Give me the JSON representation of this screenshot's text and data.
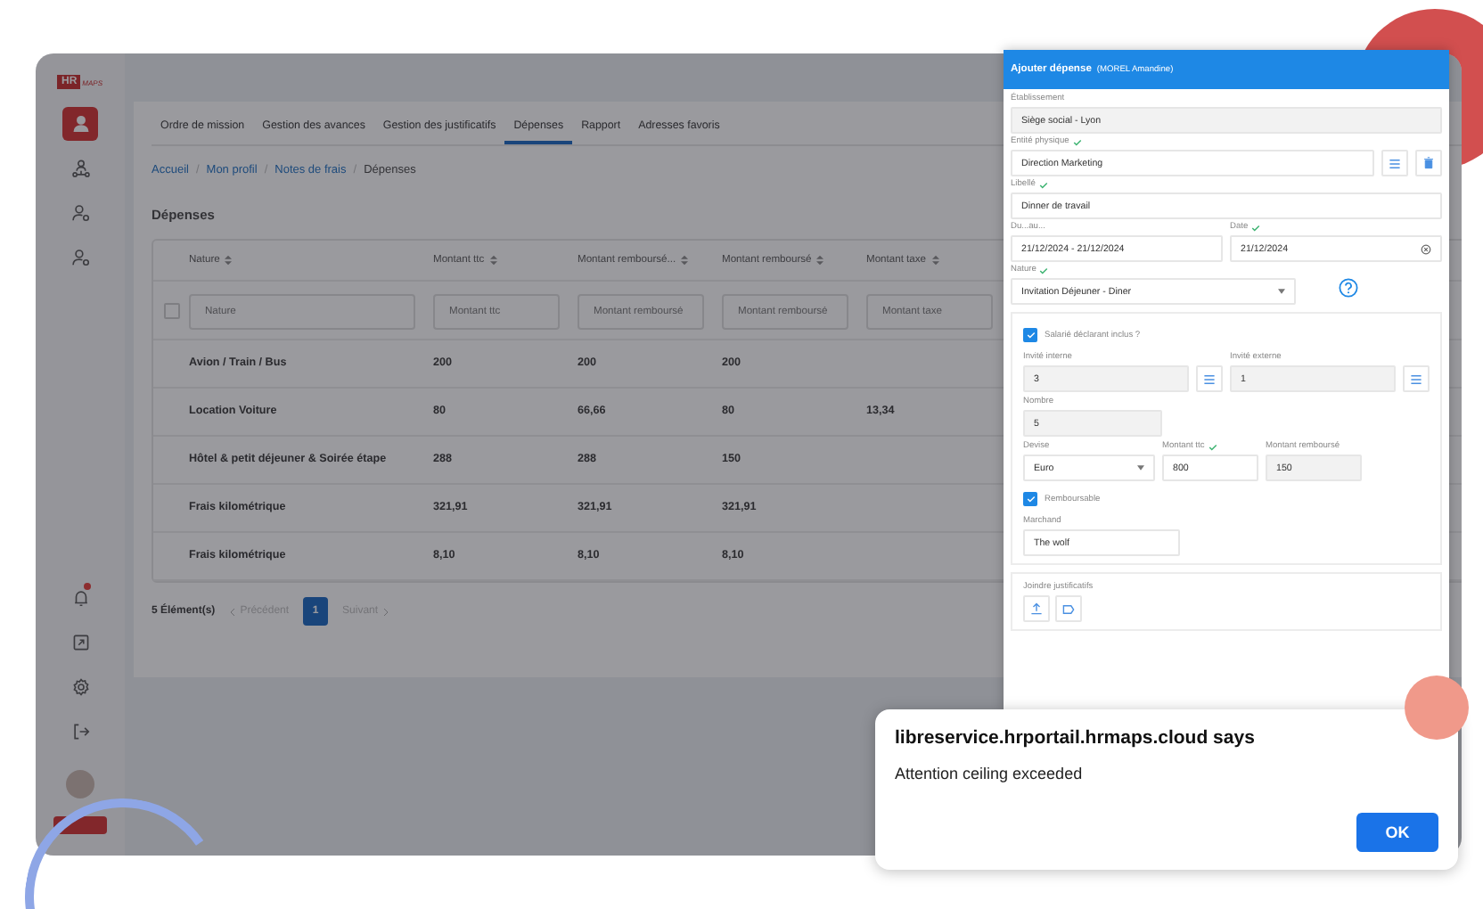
{
  "logo": {
    "mark": "HR",
    "name": "MAPS"
  },
  "sidebar": {
    "top_items": [
      {
        "kind": "person",
        "selected": true
      },
      {
        "kind": "network",
        "selected": false
      },
      {
        "kind": "person-gear",
        "selected": false
      },
      {
        "kind": "person-gear",
        "selected": false
      }
    ],
    "bottom_items": [
      {
        "kind": "bell",
        "badge": true
      },
      {
        "kind": "export",
        "badge": false
      },
      {
        "kind": "gear",
        "badge": false
      },
      {
        "kind": "logout",
        "badge": false
      }
    ]
  },
  "tabs": [
    {
      "label": "Ordre de mission",
      "selected": false
    },
    {
      "label": "Gestion des avances",
      "selected": false
    },
    {
      "label": "Gestion des justificatifs",
      "selected": false
    },
    {
      "label": "Dépenses",
      "selected": true
    },
    {
      "label": "Rapport",
      "selected": false
    },
    {
      "label": "Adresses favoris",
      "selected": false
    }
  ],
  "breadcrumb": {
    "separator": "/",
    "items": [
      {
        "label": "Accueil",
        "current": false
      },
      {
        "label": "Mon profil",
        "current": false
      },
      {
        "label": "Notes de frais",
        "current": false
      },
      {
        "label": "Dépenses",
        "current": true
      }
    ]
  },
  "page_title": "Dépenses",
  "table": {
    "columns": [
      "Nature",
      "Montant ttc",
      "Montant remboursé...",
      "Montant remboursé",
      "Montant taxe"
    ],
    "select_all": {
      "checked": false
    },
    "filters": [
      {
        "placeholder": "Nature"
      },
      {
        "placeholder": "Montant ttc"
      },
      {
        "placeholder": "Montant remboursé"
      },
      {
        "placeholder": "Montant remboursé"
      },
      {
        "placeholder": "Montant taxe"
      }
    ],
    "rows": [
      [
        "Avion / Train / Bus",
        "200",
        "200",
        "200",
        ""
      ],
      [
        "Location Voiture",
        "80",
        "66,66",
        "80",
        "13,34"
      ],
      [
        "Hôtel & petit déjeuner & Soirée étape",
        "288",
        "288",
        "150",
        ""
      ],
      [
        "Frais kilométrique",
        "321,91",
        "321,91",
        "321,91",
        ""
      ],
      [
        "Frais kilométrique",
        "8,10",
        "8,10",
        "8,10",
        ""
      ]
    ]
  },
  "pagination": {
    "count": "5 Élément(s)",
    "previous": "Précédent",
    "pages": [
      {
        "label": "1",
        "selected": true
      }
    ],
    "next": "Suivant"
  },
  "dialog": {
    "title": "Ajouter dépense",
    "subtitle": "(MOREL Amandine)",
    "rows": [
      [
        {
          "kind": "input",
          "label": "Établissement",
          "value": "Siège social - Lyon",
          "validated": false,
          "disabled": true
        }
      ],
      [
        {
          "kind": "input",
          "label": "Entité physique",
          "value": "Direction Marketing",
          "validated": true,
          "disabled": false
        },
        {
          "kind": "list-button"
        },
        {
          "kind": "trash-button"
        }
      ],
      [
        {
          "kind": "input",
          "label": "Libellé",
          "value": "Dinner de travail",
          "validated": true,
          "disabled": false
        }
      ],
      [
        {
          "kind": "input",
          "label": "Du...au...",
          "value": "21/12/2024 - 21/12/2024",
          "validated": false,
          "disabled": false
        },
        {
          "kind": "date",
          "label": "Date",
          "value": "21/12/2024",
          "validated": true,
          "disabled": false
        }
      ],
      [
        {
          "kind": "select",
          "label": "Nature",
          "value": "Invitation Déjeuner - Diner",
          "validated": true,
          "disabled": false
        },
        {
          "kind": "help"
        }
      ]
    ],
    "section_rows": [
      [
        {
          "kind": "checkbox",
          "label": "Salarié déclarant inclus ?",
          "checked": true
        }
      ],
      [
        {
          "kind": "input",
          "label": "Invité interne",
          "value": "3",
          "validated": false,
          "disabled": true
        },
        {
          "kind": "list-button"
        },
        {
          "kind": "input",
          "label": "Invité externe",
          "value": "1",
          "validated": false,
          "disabled": true
        },
        {
          "kind": "list-button"
        }
      ],
      [
        {
          "kind": "input",
          "label": "Nombre",
          "value": "5",
          "validated": false,
          "disabled": true
        }
      ],
      [
        {
          "kind": "select",
          "label": "Devise",
          "value": "Euro",
          "validated": false,
          "disabled": false
        },
        {
          "kind": "input",
          "label": "Montant ttc",
          "value": "800",
          "validated": true,
          "disabled": false
        },
        {
          "kind": "input",
          "label": "Montant remboursé",
          "value": "150",
          "validated": false,
          "disabled": true
        }
      ],
      [
        {
          "kind": "checkbox",
          "label": "Remboursable",
          "checked": true
        }
      ],
      [
        {
          "kind": "input",
          "label": "Marchand",
          "value": "The wolf",
          "validated": false,
          "disabled": false
        }
      ]
    ],
    "attachments": {
      "label": "Joindre justificatifs"
    }
  },
  "alert": {
    "title": "libreservice.hrportail.hrmaps.cloud says",
    "message": "Attention ceiling exceeded",
    "button": "OK"
  }
}
